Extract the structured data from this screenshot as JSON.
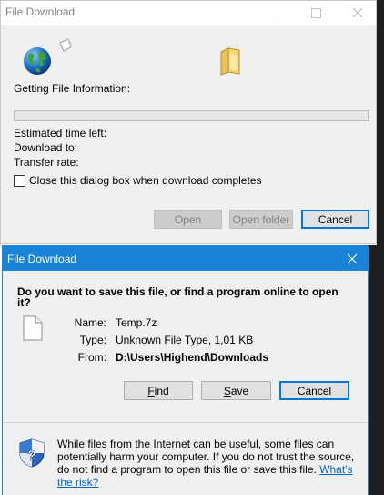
{
  "back_dialog": {
    "title": "File Download",
    "status": "Getting File Information:",
    "progress": 0,
    "estimated_label": "Estimated time left:",
    "download_to_label": "Download to:",
    "transfer_rate_label": "Transfer rate:",
    "close_checkbox_label": "Close this dialog box when download completes",
    "close_checkbox_checked": false,
    "buttons": {
      "open": "Open",
      "open_folder": "Open folder",
      "cancel": "Cancel"
    }
  },
  "front_dialog": {
    "title": "File Download",
    "question": "Do you want to save this file, or find a program online to open it?",
    "name_label": "Name:",
    "name_value": "Temp.7z",
    "type_label": "Type:",
    "type_value": "Unknown File Type, 1,01 KB",
    "from_label": "From:",
    "from_value": "D:\\Users\\Highend\\Downloads",
    "buttons": {
      "find_prefix": "F",
      "find_rest": "ind",
      "save_prefix": "S",
      "save_rest": "ave",
      "cancel": "Cancel"
    },
    "info_text": "While files from the Internet can be useful, some files can potentially harm your computer. If you do not trust the source, do not find a program to open this file or save this file.",
    "info_link": "What's the risk?"
  },
  "colors": {
    "accent": "#1883d7",
    "link": "#0066cc",
    "progress": "#06b025"
  },
  "icons": [
    "globe-icon",
    "paper-icon",
    "folder-icon",
    "close-icon",
    "document-icon",
    "shield-icon"
  ]
}
